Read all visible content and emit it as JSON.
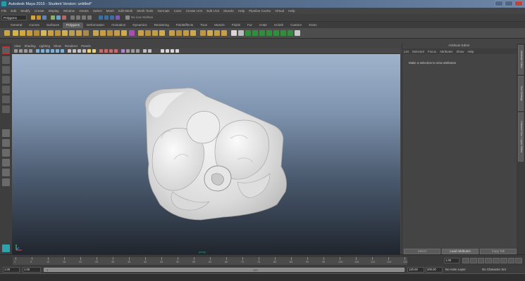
{
  "window": {
    "title": "Autodesk Maya 2015 - Student Version: untitled*"
  },
  "menubar": [
    "File",
    "Edit",
    "Modify",
    "Create",
    "Display",
    "Window",
    "Assets",
    "Select",
    "Mesh",
    "Edit Mesh",
    "Mesh Tools",
    "Normals",
    "Color",
    "Create UVs",
    "Edit UVs",
    "Muscle",
    "Help",
    "Pipeline Cache",
    "Virtual",
    "Help"
  ],
  "status_line": {
    "mode": "Polygons",
    "live_surface": "No Live Surface"
  },
  "shelf_tabs": [
    "General",
    "Curves",
    "Surfaces",
    "Polygons",
    "Deformation",
    "Animation",
    "Dynamics",
    "Rendering",
    "PaintEffects",
    "Toon",
    "Muscle",
    "Fluids",
    "Fur",
    "nHair",
    "nCloth",
    "Custom",
    "XGen"
  ],
  "shelf_active": "Polygons",
  "viewport": {
    "panel_menu": [
      "View",
      "Shading",
      "Lighting",
      "Show",
      "Renderer",
      "Panels"
    ],
    "camera_label": "persp"
  },
  "attribute_editor": {
    "title": "Attribute Editor",
    "menu": [
      "List",
      "Selected",
      "Focus",
      "Attributes",
      "Show",
      "Help"
    ],
    "message": "Make a selection to view attributes",
    "buttons": {
      "select": "Select",
      "load_attributes": "Load Attributes",
      "copy_tab": "Copy Tab"
    }
  },
  "side_tabs": [
    "Attribute Editor",
    "Tool Settings",
    "Channel Box / Layer Editor"
  ],
  "time_slider": {
    "ticks": [
      "1",
      "5",
      "10",
      "15",
      "20",
      "25",
      "30",
      "35",
      "40",
      "45",
      "50",
      "55",
      "60",
      "65",
      "70",
      "75",
      "80",
      "85",
      "90",
      "95",
      "100",
      "105",
      "110",
      "115",
      "120"
    ],
    "current_frame": "1.00"
  },
  "range": {
    "start": "1.00",
    "playback_start": "1.00",
    "slider_start": "1",
    "slider_end": "120",
    "playback_end": "120.00",
    "end": "200.00",
    "anim_layer": "No Anim Layer",
    "character_set": "No Character Set"
  }
}
